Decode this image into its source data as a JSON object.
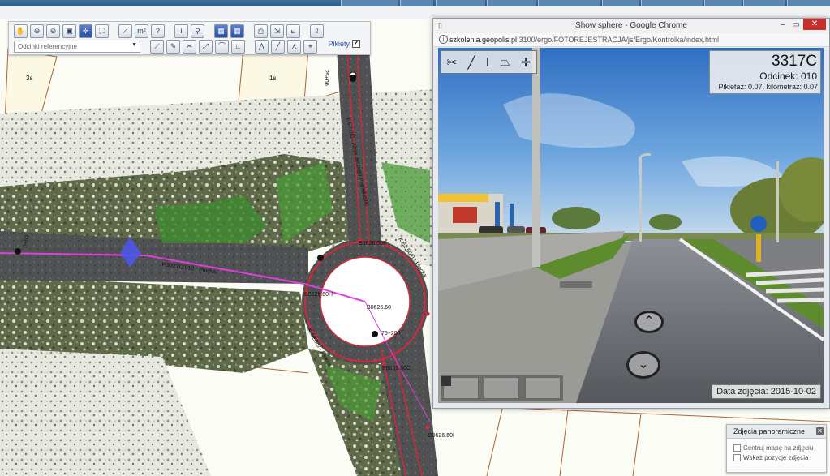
{
  "map": {
    "toolbar": {
      "layer_select_value": "Odcinki referencyjne",
      "pikiety_label": "Pikiety",
      "pikiety_checked": "✔"
    },
    "parcel_labels": [
      "3s",
      "1s"
    ],
    "labels": {
      "km_top": "25+00",
      "km_left": "0+00",
      "road_top": "K.67.0/0 - Aleja Jerzego Popiełuszki",
      "road_right": "K.62.50/0 - Płocka",
      "road_bottom": "K.62.0/0 - Płocka",
      "node_f": "B0626.60F",
      "node_h": "B0626.60H",
      "node_c": "B0626.60C",
      "node_center": "B0626.60",
      "node_b": "B0626.60I",
      "segment": "P.3317C.010 - Płocka",
      "km_ring": "75+200"
    }
  },
  "chrome": {
    "title": "Show sphere - Google Chrome",
    "url_host": "szkolenia.geopolis.pl",
    "url_path": ":3100/ergo/FOTOREJESTRACJA/js/Ergo/Kontrolka/index.html"
  },
  "viewer": {
    "road_number": "3317C",
    "odcinek": "Odcinek: 010",
    "pikietaz": "Pikietaż: 0.07, kilometraż: 0.07",
    "date": "Data zdjęcia: 2015-10-02",
    "shop_sign": "AZY BUDOWLANE"
  },
  "panel": {
    "title": "Zdjęcia panoramiczne",
    "option1": "Centruj mapę na zdjęciu",
    "option2": "Wskaż pozycję zdjęcia"
  },
  "colors": {
    "ring": "#d8273a",
    "road_line": "#d4206a",
    "segment": "#e23de3",
    "parcel": "#b0622e"
  }
}
